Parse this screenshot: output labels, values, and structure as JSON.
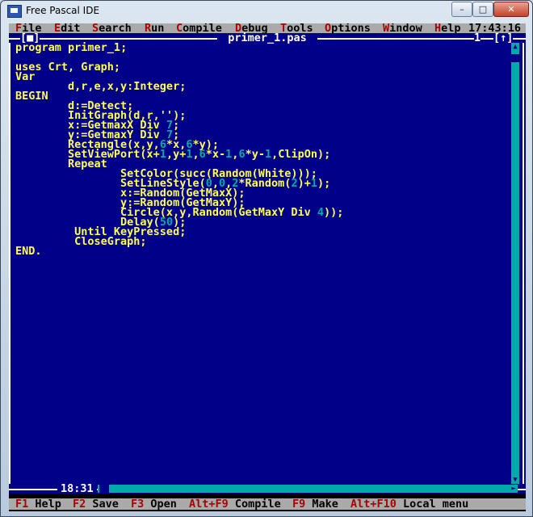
{
  "window": {
    "title": "Free Pascal IDE",
    "minimize_glyph": "–",
    "maximize_glyph": "□",
    "close_glyph": "✕"
  },
  "menubar": {
    "items": [
      {
        "hotkey": "F",
        "rest": "ile"
      },
      {
        "hotkey": "E",
        "rest": "dit"
      },
      {
        "hotkey": "S",
        "rest": "earch"
      },
      {
        "hotkey": "R",
        "rest": "un"
      },
      {
        "hotkey": "C",
        "rest": "ompile"
      },
      {
        "hotkey": "D",
        "rest": "ebug"
      },
      {
        "hotkey": "T",
        "rest": "ools"
      },
      {
        "hotkey": "O",
        "rest": "ptions"
      },
      {
        "hotkey": "W",
        "rest": "indow"
      },
      {
        "hotkey": "H",
        "rest": "elp"
      }
    ],
    "clock": "17:43:16"
  },
  "editor": {
    "filename": "primer_1.pas",
    "close_box": "[■]",
    "window_number": "1",
    "zoom_box": "[↑]",
    "cursor_position": "18:31",
    "code": [
      "program primer_1;",
      "",
      "uses Crt, Graph;",
      "Var",
      "        d,r,e,x,y:Integer;",
      "BEGIN",
      "        d:=Detect;",
      "        InitGraph(d,r,'');",
      "        x:=GetmaxX Div 7;",
      "        y:=GetmaxY Div 7;",
      "        Rectangle(x,y,6*x,6*y);",
      "        SetViewPort(x+1,y+1,6*x-1,6*y-1,ClipOn);",
      "        Repeat",
      "                SetColor(succ(Random(White)));",
      "                SetLineStyle(0,0,2*Random(2)+1);",
      "                x:=Random(GetMaxX);",
      "                y:=Random(GetMaxY);",
      "                Circle(x,y,Random(GetMaxY Div 4));",
      "                Delay(50);",
      "         Until KeyPressed;",
      "         CloseGraph;",
      "END."
    ]
  },
  "statusbar": {
    "items": [
      {
        "key": "F1",
        "label": " Help"
      },
      {
        "key": "F2",
        "label": " Save"
      },
      {
        "key": "F3",
        "label": " Open"
      },
      {
        "key": "Alt+F9",
        "label": " Compile"
      },
      {
        "key": "F9",
        "label": " Make"
      },
      {
        "key": "Alt+F10",
        "label": " Local menu"
      }
    ]
  },
  "colors": {
    "editor_bg": "#000088",
    "code_text": "#ffff55",
    "numbers": "#00aaaa",
    "menu_bg": "#aaaaaa",
    "hotkey": "#aa0000"
  }
}
